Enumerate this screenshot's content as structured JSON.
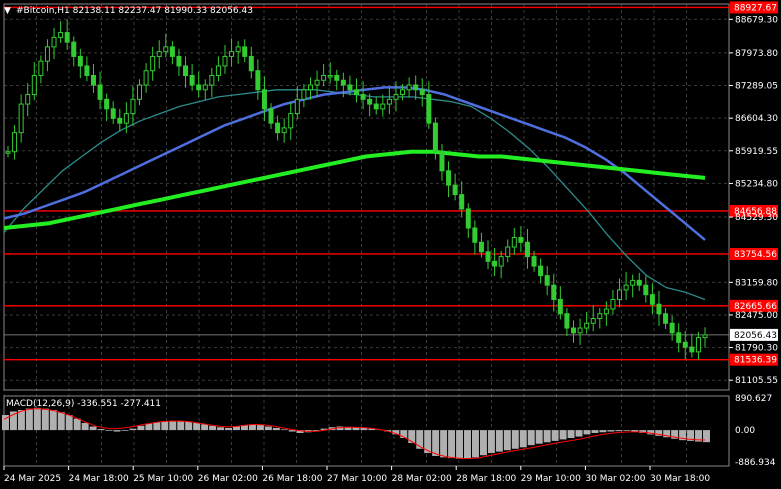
{
  "header": {
    "title": "#Bitcoin,H1  82138.11 82237.47 81990.33 82056.43"
  },
  "macd_panel": {
    "label": "MACD(12,26,9) -336.551 -277.411"
  },
  "colors": {
    "background": "#000000",
    "grid": "#3a3a3a",
    "candle": "#33cc33",
    "ma_teal": "#2e8b8b",
    "ma_blue": "#4f6fe0",
    "ma_green": "#22ee22",
    "level_line": "#ff0000",
    "level_tag": "#ff0000",
    "current_price_tag": "#ffffff",
    "macd_hist": "#b0b0b0",
    "macd_signal": "#ff0000"
  },
  "chart_data": [
    {
      "type": "candlestick",
      "title": "#Bitcoin,H1  82138.11 82237.47 81990.33 82056.43",
      "symbol": "#Bitcoin",
      "timeframe": "H1",
      "ohlc_current": {
        "open": 82138.11,
        "high": 82237.47,
        "low": 81990.33,
        "close": 82056.43
      },
      "ylim": [
        80900,
        89000
      ],
      "y_ticks": [
        "88679.30",
        "87973.80",
        "87289.05",
        "86604.30",
        "85919.55",
        "85234.80",
        "84529.30",
        "83159.80",
        "82475.00",
        "81790.30",
        "81105.55"
      ],
      "x_ticks": [
        "24 Mar 2025",
        "24 Mar 18:00",
        "25 Mar 10:00",
        "26 Mar 02:00",
        "26 Mar 18:00",
        "27 Mar 10:00",
        "28 Mar 02:00",
        "28 Mar 18:00",
        "29 Mar 10:00",
        "30 Mar 02:00",
        "30 Mar 18:00"
      ],
      "horizontal_levels": [
        {
          "label": "88927.67",
          "value": 88927.67
        },
        {
          "label": "84656.88",
          "value": 84656.88
        },
        {
          "label": "83754.56",
          "value": 83754.56
        },
        {
          "label": "82665.66",
          "value": 82665.66
        },
        {
          "label": "81536.39",
          "value": 81536.39
        }
      ],
      "current_price": {
        "label": "82056.43",
        "value": 82056.43
      },
      "close_series": [
        85900,
        86300,
        86900,
        87100,
        87500,
        87800,
        88100,
        88300,
        88400,
        88200,
        87900,
        87700,
        87500,
        87300,
        87000,
        86800,
        86600,
        86500,
        86700,
        87000,
        87300,
        87600,
        87900,
        88000,
        88100,
        87900,
        87700,
        87500,
        87300,
        87200,
        87300,
        87500,
        87700,
        87900,
        88000,
        88100,
        87900,
        87600,
        87200,
        86800,
        86500,
        86300,
        86400,
        86700,
        87000,
        87200,
        87300,
        87400,
        87500,
        87500,
        87400,
        87300,
        87200,
        87100,
        87000,
        86900,
        86800,
        86900,
        87000,
        87100,
        87200,
        87300,
        87200,
        87100,
        86500,
        85900,
        85500,
        85200,
        85000,
        84700,
        84300,
        84000,
        83800,
        83600,
        83500,
        83700,
        83900,
        84100,
        84000,
        83700,
        83500,
        83300,
        83100,
        82800,
        82500,
        82200,
        82100,
        82200,
        82300,
        82400,
        82500,
        82600,
        82800,
        83000,
        83100,
        83200,
        83100,
        82900,
        82700,
        82500,
        82300,
        82100,
        81900,
        81800,
        81700,
        82000,
        82056
      ],
      "moving_averages": [
        {
          "name": "",
          "color": "#2e8b8b",
          "values": [
            84200,
            84700,
            85100,
            85500,
            85800,
            86100,
            86350,
            86550,
            86700,
            86850,
            86950,
            87050,
            87100,
            87150,
            87200,
            87200,
            87200,
            87150,
            87100,
            87050,
            87050,
            87050,
            87000,
            86950,
            86850,
            86600,
            86300,
            85950,
            85550,
            85100,
            84650,
            84150,
            83700,
            83300,
            83050,
            82950,
            82800
          ]
        },
        {
          "name": "",
          "color": "#4f6fe0",
          "values": [
            84500,
            84600,
            84750,
            84900,
            85050,
            85250,
            85450,
            85650,
            85850,
            86050,
            86250,
            86450,
            86600,
            86750,
            86900,
            87000,
            87100,
            87150,
            87200,
            87250,
            87250,
            87200,
            87100,
            86950,
            86800,
            86650,
            86500,
            86350,
            86200,
            86000,
            85750,
            85450,
            85100,
            84750,
            84400,
            84050
          ]
        },
        {
          "name": "",
          "color": "#22ee22",
          "values": [
            84300,
            84350,
            84400,
            84500,
            84600,
            84700,
            84800,
            84900,
            85000,
            85100,
            85200,
            85300,
            85400,
            85500,
            85600,
            85700,
            85800,
            85850,
            85900,
            85900,
            85850,
            85800,
            85800,
            85750,
            85700,
            85650,
            85600,
            85550,
            85500,
            85450,
            85400,
            85350
          ]
        }
      ]
    },
    {
      "type": "bar",
      "title": "MACD(12,26,9) -336.551 -277.411",
      "ylim": [
        -1000,
        950
      ],
      "y_ticks": [
        "890.627",
        "0.00",
        "-886.934"
      ],
      "histogram": [
        420,
        520,
        560,
        600,
        620,
        600,
        560,
        500,
        420,
        320,
        200,
        100,
        30,
        -20,
        -40,
        -20,
        40,
        120,
        180,
        220,
        240,
        260,
        260,
        240,
        200,
        160,
        120,
        80,
        60,
        100,
        140,
        160,
        140,
        100,
        60,
        20,
        -40,
        -80,
        -60,
        0,
        40,
        80,
        100,
        90,
        70,
        60,
        40,
        10,
        -40,
        -120,
        -220,
        -360,
        -520,
        -640,
        -720,
        -760,
        -780,
        -800,
        -800,
        -760,
        -700,
        -640,
        -600,
        -560,
        -520,
        -480,
        -420,
        -380,
        -340,
        -300,
        -260,
        -220,
        -180,
        -120,
        -80,
        -60,
        -40,
        -30,
        -20,
        -40,
        -80,
        -120,
        -160,
        -200,
        -240,
        -280,
        -300,
        -320,
        -336
      ],
      "signal": [
        300,
        420,
        520,
        580,
        600,
        580,
        540,
        480,
        400,
        300,
        200,
        110,
        60,
        40,
        50,
        80,
        120,
        170,
        210,
        240,
        250,
        250,
        240,
        210,
        170,
        130,
        100,
        90,
        110,
        140,
        160,
        150,
        120,
        80,
        40,
        0,
        -30,
        -40,
        -20,
        20,
        60,
        80,
        80,
        70,
        50,
        20,
        -30,
        -100,
        -200,
        -340,
        -480,
        -600,
        -680,
        -740,
        -770,
        -790,
        -790,
        -770,
        -720,
        -670,
        -620,
        -580,
        -540,
        -500,
        -460,
        -410,
        -370,
        -330,
        -290,
        -250,
        -200,
        -150,
        -110,
        -80,
        -60,
        -50,
        -50,
        -70,
        -100,
        -140,
        -180,
        -220,
        -250,
        -270,
        -277
      ]
    }
  ]
}
